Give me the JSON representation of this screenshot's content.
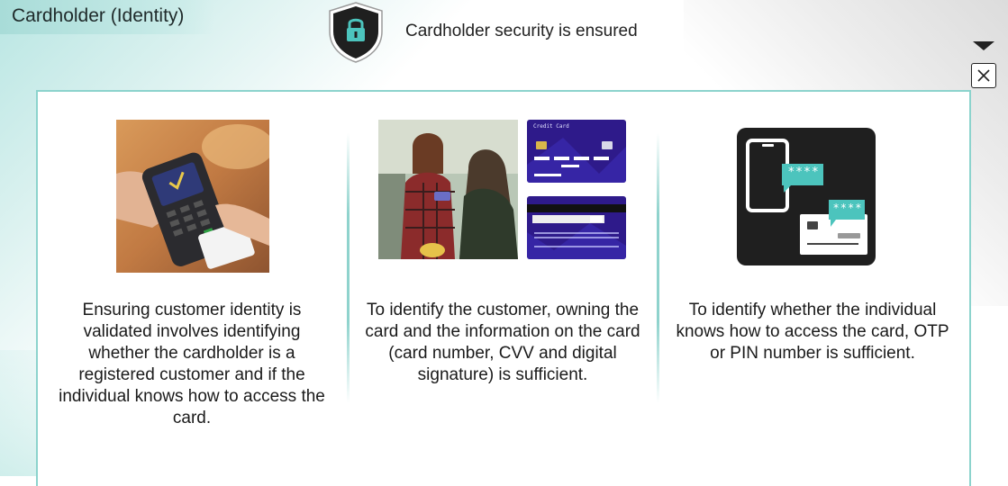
{
  "header": {
    "title": "Cardholder (Identity)",
    "security_text": "Cardholder security is ensured"
  },
  "icons": {
    "shield": "shield-lock-icon",
    "menu": "triangle-down-icon",
    "close": "close-icon"
  },
  "colors": {
    "accent_teal": "#8cd3cd",
    "shield_fill": "#1f1f1f",
    "lock_teal": "#4cc4bd"
  },
  "columns": [
    {
      "image": "payment-terminal-photo",
      "text": "Ensuring customer identity is validated involves identifying whether the cardholder is a registered customer and if the individual knows how to access the card."
    },
    {
      "image": "cashier-and-credit-card-photos",
      "card_front_label": "Credit Card",
      "text": "To identify the customer, owning the card and the information on the card (card number, CVV and digital signature) is sufficient."
    },
    {
      "image": "phone-otp-card-illustration",
      "otp_bubble_1": "****",
      "otp_bubble_2": "****",
      "text": "To identify whether the individual knows how to access the card, OTP or PIN number is sufficient."
    }
  ]
}
